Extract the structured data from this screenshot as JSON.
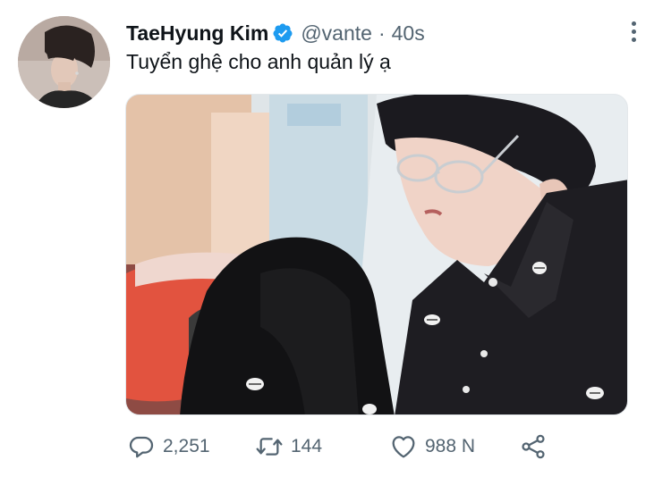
{
  "author": {
    "display_name": "TaeHyung Kim",
    "handle": "@vante",
    "separator": "·",
    "time": "40s"
  },
  "tweet": {
    "text": "Tuyển ghệ cho anh quản lý ạ"
  },
  "actions": {
    "replies": "2,251",
    "retweets": "144",
    "likes": "988 N"
  },
  "icons": {
    "verified": "verified-badge-icon",
    "more": "more-vertical-icon",
    "reply": "reply-icon",
    "retweet": "retweet-icon",
    "like": "heart-icon",
    "share": "share-icon"
  },
  "colors": {
    "verified_blue": "#1d9bf0",
    "secondary_text": "#536471",
    "primary_text": "#0f1419"
  }
}
